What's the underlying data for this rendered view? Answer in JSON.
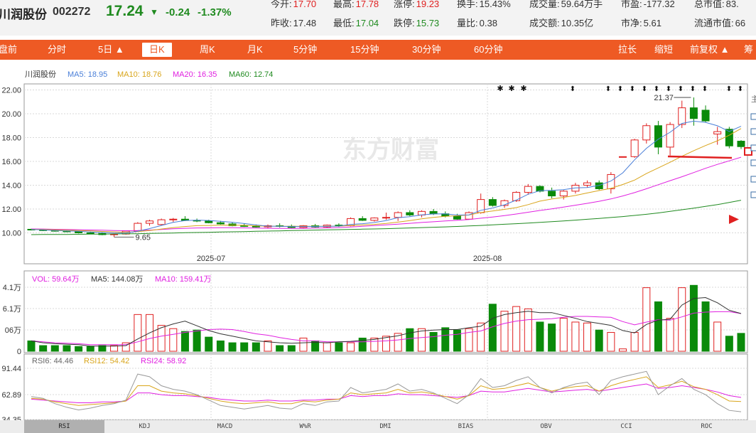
{
  "header": {
    "name": "川润股份",
    "code": "002272",
    "price": "17.24",
    "arrow": "▼",
    "change": "-0.24",
    "change_pct": "-1.37%",
    "row1": [
      {
        "label": "今开:",
        "value": "17.70",
        "color": "red"
      },
      {
        "label": "最高:",
        "value": "17.78",
        "color": "red"
      },
      {
        "label": "涨停:",
        "value": "19.23",
        "color": "red"
      },
      {
        "label": "换手:",
        "value": "15.43%",
        "color": "default"
      },
      {
        "label": "成交量:",
        "value": "59.64万手",
        "color": "default"
      },
      {
        "label": "市盈:",
        "value": "-177.32",
        "color": "default"
      },
      {
        "label": "总市值:",
        "value": "83.",
        "color": "default"
      }
    ],
    "row2": [
      {
        "label": "昨收:",
        "value": "17.48",
        "color": "default"
      },
      {
        "label": "最低:",
        "value": "17.04",
        "color": "green"
      },
      {
        "label": "跌停:",
        "value": "15.73",
        "color": "green"
      },
      {
        "label": "量比:",
        "value": "0.38",
        "color": "default"
      },
      {
        "label": "成交额:",
        "value": "10.35亿",
        "color": "default"
      },
      {
        "label": "市净:",
        "value": "5.61",
        "color": "default"
      },
      {
        "label": "流通市值:",
        "value": "66",
        "color": "default"
      }
    ]
  },
  "tabs": {
    "left": [
      "盘前",
      "分时",
      "5日 ▲",
      "日K",
      "周K",
      "月K",
      "5分钟",
      "15分钟",
      "30分钟",
      "60分钟"
    ],
    "active": "日K",
    "right": [
      "拉长",
      "缩短",
      "前复权 ▲",
      "筹"
    ]
  },
  "legend": {
    "name": "川润股份",
    "ma5": "MA5: 18.95",
    "ma10": "MA10: 18.76",
    "ma20": "MA20: 16.35",
    "ma60": "MA60: 12.74",
    "vol": "VOL: 59.64万",
    "vma5": "MA5: 144.08万",
    "vma10": "MA10: 159.41万",
    "rsi6": "RSI6: 44.46",
    "rsi12": "RSI12: 54.42",
    "rsi24": "RSI24: 58.92"
  },
  "axes": {
    "price_ticks": [
      "22.00",
      "20.00",
      "18.00",
      "16.00",
      "14.00",
      "12.00",
      "10.00"
    ],
    "date_ticks": [
      "2025-07",
      "2025-08"
    ],
    "vol_ticks": [
      "4.1万",
      "6.1万",
      "06万",
      "0"
    ],
    "rsi_ticks": [
      "91.44",
      "62.89",
      "34.35"
    ]
  },
  "annotations": {
    "high": "21.37",
    "low": "9.65"
  },
  "watermark": "东方财富",
  "side_label": "主",
  "bottom_tabs": [
    "RSI",
    "KDJ",
    "MACD",
    "W%R",
    "DMI",
    "BIAS",
    "OBV",
    "CCI",
    "ROC"
  ],
  "bottom_active": "RSI",
  "colors": {
    "up": "#e02020",
    "down": "#0a8a0a",
    "ma5": "#4a7fd8",
    "ma10": "#d9a51b",
    "ma20": "#e020e0",
    "ma60": "#1f8a1f",
    "accent": "#ee5a24"
  },
  "chart_data": {
    "type": "candlestick",
    "ylim": [
      9,
      22.5
    ],
    "candles": [
      [
        10.3,
        10.35,
        10.2,
        10.25
      ],
      [
        10.25,
        10.3,
        10.15,
        10.2
      ],
      [
        10.2,
        10.25,
        10.1,
        10.15
      ],
      [
        10.15,
        10.2,
        10.05,
        10.1
      ],
      [
        10.1,
        10.15,
        9.95,
        10.0
      ],
      [
        10.0,
        10.1,
        9.9,
        9.95
      ],
      [
        9.95,
        10.0,
        9.8,
        9.85
      ],
      [
        9.85,
        9.95,
        9.65,
        9.9
      ],
      [
        9.9,
        10.2,
        9.85,
        10.15
      ],
      [
        10.15,
        10.9,
        10.1,
        10.8
      ],
      [
        10.8,
        11.1,
        10.6,
        11.0
      ],
      [
        10.7,
        11.2,
        10.6,
        11.1
      ],
      [
        11.1,
        11.25,
        10.9,
        11.15
      ],
      [
        11.15,
        11.4,
        11.0,
        11.05
      ],
      [
        11.05,
        11.2,
        10.9,
        11.0
      ],
      [
        11.0,
        11.1,
        10.8,
        10.85
      ],
      [
        10.85,
        11.0,
        10.7,
        10.75
      ],
      [
        10.75,
        10.9,
        10.55,
        10.6
      ],
      [
        10.6,
        10.8,
        10.5,
        10.55
      ],
      [
        10.55,
        10.7,
        10.45,
        10.5
      ],
      [
        10.5,
        10.7,
        10.4,
        10.6
      ],
      [
        10.6,
        10.8,
        10.45,
        10.55
      ],
      [
        10.55,
        10.7,
        10.4,
        10.45
      ],
      [
        10.45,
        10.65,
        10.35,
        10.6
      ],
      [
        10.6,
        10.75,
        10.45,
        10.5
      ],
      [
        10.5,
        10.7,
        10.4,
        10.65
      ],
      [
        10.65,
        10.8,
        10.5,
        10.6
      ],
      [
        10.6,
        11.3,
        10.55,
        11.2
      ],
      [
        11.2,
        11.4,
        11.0,
        11.05
      ],
      [
        11.05,
        11.3,
        10.95,
        11.25
      ],
      [
        11.25,
        11.7,
        11.1,
        11.3
      ],
      [
        11.3,
        11.8,
        11.0,
        11.7
      ],
      [
        11.7,
        11.9,
        11.4,
        11.5
      ],
      [
        11.5,
        11.9,
        11.3,
        11.8
      ],
      [
        11.8,
        12.0,
        11.5,
        11.6
      ],
      [
        11.6,
        11.8,
        11.3,
        11.4
      ],
      [
        11.4,
        11.6,
        11.1,
        11.15
      ],
      [
        11.15,
        11.8,
        11.1,
        11.7
      ],
      [
        11.7,
        13.3,
        11.6,
        12.8
      ],
      [
        12.8,
        13.0,
        12.2,
        12.3
      ],
      [
        12.3,
        12.8,
        12.1,
        12.7
      ],
      [
        12.7,
        13.5,
        12.6,
        13.4
      ],
      [
        13.4,
        14.1,
        13.2,
        13.9
      ],
      [
        13.9,
        14.0,
        13.4,
        13.5
      ],
      [
        13.5,
        13.8,
        12.9,
        13.1
      ],
      [
        13.1,
        13.6,
        12.8,
        13.5
      ],
      [
        13.5,
        14.2,
        13.3,
        14.0
      ],
      [
        14.0,
        14.4,
        13.8,
        14.2
      ],
      [
        14.2,
        14.4,
        13.6,
        13.7
      ],
      [
        13.7,
        15.1,
        13.3,
        14.9
      ],
      [
        16.4,
        16.4,
        16.4,
        16.4
      ],
      [
        16.4,
        17.9,
        16.3,
        17.8
      ],
      [
        17.8,
        19.2,
        17.5,
        19.0
      ],
      [
        19.0,
        19.4,
        16.6,
        17.2
      ],
      [
        17.2,
        19.3,
        16.5,
        19.1
      ],
      [
        19.1,
        21.1,
        18.8,
        20.5
      ],
      [
        20.5,
        21.37,
        19.0,
        19.6
      ],
      [
        20.3,
        20.7,
        19.3,
        19.4
      ],
      [
        18.3,
        18.9,
        17.4,
        18.5
      ],
      [
        18.7,
        18.9,
        17.1,
        17.3
      ],
      [
        17.7,
        17.78,
        17.04,
        17.24
      ]
    ],
    "ma5": [
      10.28,
      10.25,
      10.2,
      10.17,
      10.13,
      10.08,
      10.03,
      9.99,
      9.99,
      10.13,
      10.36,
      10.62,
      10.88,
      11.03,
      11.07,
      11.04,
      10.97,
      10.89,
      10.78,
      10.66,
      10.56,
      10.55,
      10.53,
      10.53,
      10.54,
      10.55,
      10.57,
      10.71,
      10.77,
      10.87,
      11.03,
      11.28,
      11.36,
      11.51,
      11.59,
      11.6,
      11.49,
      11.51,
      11.89,
      12.09,
      12.35,
      12.75,
      13.24,
      13.54,
      13.57,
      13.63,
      13.78,
      13.81,
      13.98,
      14.35,
      15.04,
      16.13,
      17.1,
      17.86,
      18.45,
      19.19,
      19.38,
      19.28,
      18.99,
      18.52,
      18.95
    ],
    "ma10": [
      10.3,
      10.28,
      10.25,
      10.22,
      10.19,
      10.16,
      10.12,
      10.09,
      10.05,
      10.1,
      10.2,
      10.32,
      10.44,
      10.53,
      10.6,
      10.62,
      10.64,
      10.65,
      10.63,
      10.59,
      10.56,
      10.55,
      10.55,
      10.55,
      10.55,
      10.55,
      10.56,
      10.62,
      10.66,
      10.71,
      10.79,
      10.9,
      11.03,
      11.18,
      11.3,
      11.39,
      11.43,
      11.5,
      11.71,
      11.84,
      11.97,
      12.12,
      12.37,
      12.66,
      12.84,
      12.98,
      13.14,
      13.35,
      13.55,
      13.74,
      14.06,
      14.43,
      14.98,
      15.45,
      15.93,
      16.43,
      16.9,
      17.33,
      17.73,
      18.2,
      18.76
    ],
    "ma20": [
      10.33,
      10.32,
      10.3,
      10.28,
      10.26,
      10.24,
      10.22,
      10.2,
      10.18,
      10.19,
      10.23,
      10.28,
      10.34,
      10.38,
      10.41,
      10.42,
      10.43,
      10.43,
      10.42,
      10.4,
      10.38,
      10.37,
      10.37,
      10.38,
      10.4,
      10.42,
      10.45,
      10.49,
      10.55,
      10.61,
      10.67,
      10.73,
      10.8,
      10.87,
      10.93,
      11.0,
      11.05,
      11.12,
      11.23,
      11.33,
      11.45,
      11.58,
      11.73,
      11.88,
      12.02,
      12.17,
      12.32,
      12.48,
      12.65,
      12.85,
      13.1,
      13.38,
      13.7,
      14.04,
      14.38,
      14.71,
      15.06,
      15.42,
      15.75,
      16.05,
      16.35
    ],
    "ma60": [
      9.85,
      9.86,
      9.86,
      9.87,
      9.88,
      9.89,
      9.9,
      9.91,
      9.92,
      9.93,
      9.95,
      9.97,
      9.99,
      10.01,
      10.03,
      10.05,
      10.07,
      10.09,
      10.11,
      10.13,
      10.15,
      10.17,
      10.19,
      10.21,
      10.23,
      10.25,
      10.27,
      10.29,
      10.31,
      10.33,
      10.35,
      10.38,
      10.41,
      10.44,
      10.47,
      10.5,
      10.54,
      10.58,
      10.62,
      10.67,
      10.72,
      10.77,
      10.82,
      10.88,
      10.94,
      11.0,
      11.07,
      11.14,
      11.21,
      11.29,
      11.37,
      11.46,
      11.56,
      11.67,
      11.8,
      11.94,
      12.08,
      12.22,
      12.37,
      12.55,
      12.74
    ],
    "volume": [
      0.22,
      0.12,
      0.12,
      0.12,
      0.1,
      0.1,
      0.12,
      0.12,
      0.18,
      0.78,
      0.78,
      0.55,
      0.48,
      0.42,
      0.45,
      0.3,
      0.22,
      0.18,
      0.18,
      0.18,
      0.22,
      0.12,
      0.12,
      0.28,
      0.22,
      0.18,
      0.18,
      0.18,
      0.28,
      0.28,
      0.32,
      0.38,
      0.48,
      0.48,
      0.4,
      0.5,
      0.45,
      0.48,
      0.6,
      1.0,
      0.85,
      0.95,
      0.9,
      0.62,
      0.58,
      0.7,
      0.62,
      0.6,
      0.45,
      0.4,
      0.05,
      0.4,
      1.35,
      1.05,
      0.7,
      1.35,
      1.4,
      1.05,
      0.62,
      0.32,
      0.38
    ],
    "vol_ma5": [
      0.22,
      0.18,
      0.16,
      0.15,
      0.14,
      0.11,
      0.11,
      0.11,
      0.12,
      0.26,
      0.39,
      0.5,
      0.58,
      0.64,
      0.54,
      0.44,
      0.37,
      0.32,
      0.27,
      0.22,
      0.2,
      0.18,
      0.17,
      0.18,
      0.19,
      0.18,
      0.2,
      0.21,
      0.23,
      0.25,
      0.29,
      0.33,
      0.39,
      0.43,
      0.45,
      0.46,
      0.46,
      0.5,
      0.53,
      0.7,
      0.78,
      0.82,
      0.85,
      0.82,
      0.82,
      0.76,
      0.7,
      0.63,
      0.59,
      0.55,
      0.44,
      0.39,
      0.57,
      0.66,
      0.68,
      0.98,
      1.12,
      1.14,
      1.03,
      0.87,
      0.8
    ],
    "vol_ma10": [
      0.22,
      0.2,
      0.18,
      0.17,
      0.16,
      0.14,
      0.14,
      0.14,
      0.14,
      0.2,
      0.27,
      0.32,
      0.36,
      0.4,
      0.43,
      0.46,
      0.47,
      0.46,
      0.42,
      0.37,
      0.34,
      0.29,
      0.25,
      0.22,
      0.22,
      0.2,
      0.2,
      0.2,
      0.2,
      0.21,
      0.22,
      0.24,
      0.27,
      0.29,
      0.31,
      0.34,
      0.36,
      0.4,
      0.43,
      0.52,
      0.59,
      0.64,
      0.67,
      0.68,
      0.69,
      0.72,
      0.74,
      0.74,
      0.73,
      0.72,
      0.63,
      0.56,
      0.62,
      0.67,
      0.66,
      0.73,
      0.81,
      0.83,
      0.84,
      0.84,
      0.8
    ],
    "rsi6": [
      60,
      58,
      52,
      48,
      45,
      47,
      50,
      52,
      56,
      85,
      82,
      72,
      68,
      66,
      62,
      56,
      50,
      48,
      46,
      48,
      50,
      47,
      46,
      52,
      50,
      54,
      55,
      70,
      64,
      66,
      68,
      74,
      66,
      68,
      64,
      58,
      52,
      62,
      80,
      70,
      72,
      78,
      82,
      70,
      64,
      70,
      74,
      76,
      62,
      78,
      82,
      85,
      88,
      62,
      72,
      80,
      68,
      62,
      52,
      44.46,
      43
    ],
    "rsi12": [
      58,
      57,
      54,
      52,
      50,
      51,
      52,
      53,
      55,
      72,
      72,
      66,
      64,
      63,
      61,
      58,
      55,
      53,
      52,
      53,
      54,
      52,
      52,
      55,
      54,
      56,
      57,
      64,
      62,
      63,
      64,
      68,
      64,
      65,
      63,
      60,
      57,
      61,
      72,
      68,
      69,
      72,
      75,
      70,
      66,
      69,
      71,
      72,
      66,
      72,
      76,
      79,
      82,
      70,
      73,
      77,
      71,
      68,
      62,
      55,
      54.42
    ],
    "rsi24": [
      57,
      56,
      55,
      54,
      53,
      53,
      54,
      54,
      55,
      64,
      64,
      62,
      61,
      61,
      60,
      59,
      57,
      56,
      55,
      55,
      56,
      55,
      55,
      56,
      56,
      57,
      57,
      61,
      60,
      61,
      61,
      63,
      62,
      62,
      61,
      60,
      59,
      61,
      66,
      65,
      65,
      67,
      69,
      67,
      65,
      66,
      67,
      68,
      66,
      68,
      70,
      72,
      74,
      69,
      70,
      72,
      70,
      68,
      65,
      61,
      58.92
    ],
    "rsi_ylim": [
      34.35,
      91.44
    ]
  }
}
